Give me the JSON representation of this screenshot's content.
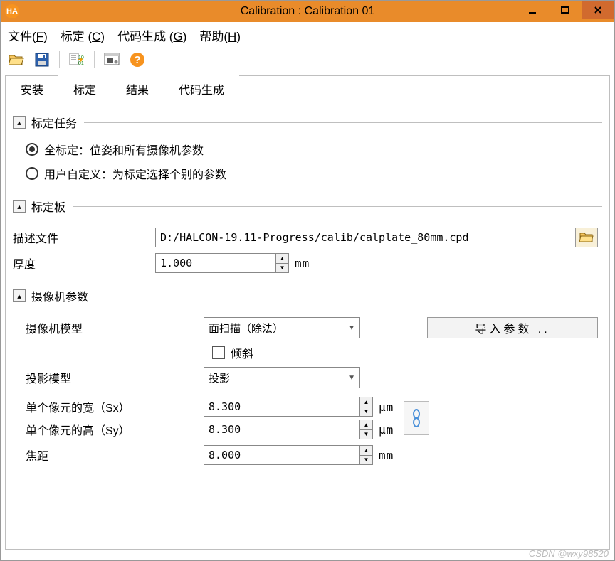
{
  "title": "Calibration : Calibration 01",
  "menu": {
    "file": "文件",
    "file_hot": "F",
    "calib": "标定",
    "calib_hot": "C",
    "codegen": "代码生成",
    "codegen_hot": "G",
    "help": "帮助",
    "help_hot": "H"
  },
  "tabs": {
    "install": "安装",
    "calib": "标定",
    "result": "结果",
    "codegen": "代码生成"
  },
  "section_task": {
    "title": "标定任务",
    "opt_full": "全标定：位姿和所有摄像机参数",
    "opt_user": "用户自定义：为标定选择个别的参数"
  },
  "section_plate": {
    "title": "标定板",
    "desc_label": "描述文件",
    "desc_value": "D:/HALCON-19.11-Progress/calib/calplate_80mm.cpd",
    "thick_label": "厚度",
    "thick_value": "1.000",
    "thick_unit": "mm"
  },
  "section_cam": {
    "title": "摄像机参数",
    "model_label": "摄像机模型",
    "model_value": "面扫描（除法）",
    "import_btn": "导入参数 ..",
    "tilt_label": "倾斜",
    "proj_label": "投影模型",
    "proj_value": "投影",
    "sx_label": "单个像元的宽（Sx）",
    "sx_value": "8.300",
    "sx_unit": "μm",
    "sy_label": "单个像元的高（Sy）",
    "sy_value": "8.300",
    "sy_unit": "μm",
    "focal_label": "焦距",
    "focal_value": "8.000",
    "focal_unit": "mm"
  },
  "watermark": "CSDN @wxy98520"
}
